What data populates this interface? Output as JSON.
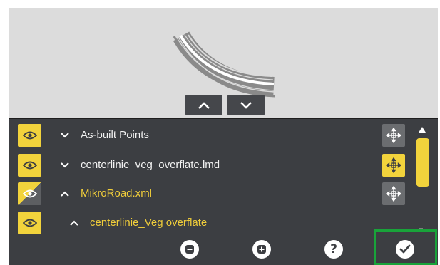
{
  "preview": {
    "nav": {
      "up_label": "up-arrow",
      "down_label": "down-arrow"
    }
  },
  "layers": [
    {
      "name": "As-built Points",
      "expanded": false,
      "visible": true,
      "color": "#f2f2f2",
      "move_active": false
    },
    {
      "name": "centerlinie_veg_overflate.lmd",
      "expanded": false,
      "visible": true,
      "color": "#f2f2f2",
      "move_active": true
    },
    {
      "name": "MikroRoad.xml",
      "expanded": true,
      "visible": "partial",
      "color": "#f0cd3a",
      "move_active": false
    },
    {
      "name": "centerlinie_Veg overflate",
      "expanded": true,
      "visible": true,
      "color": "#f0cd3a",
      "move_active": null
    }
  ],
  "toolbar": {
    "remove_icon": "remove-layer-icon",
    "add_icon": "add-layer-icon",
    "help_label": "?",
    "confirm_icon": "checkmark-icon"
  },
  "colors": {
    "accent": "#f2d33c",
    "panel": "#3c3e42",
    "preview_bg": "#dcdcdc",
    "confirm_highlight": "#19a33a"
  }
}
